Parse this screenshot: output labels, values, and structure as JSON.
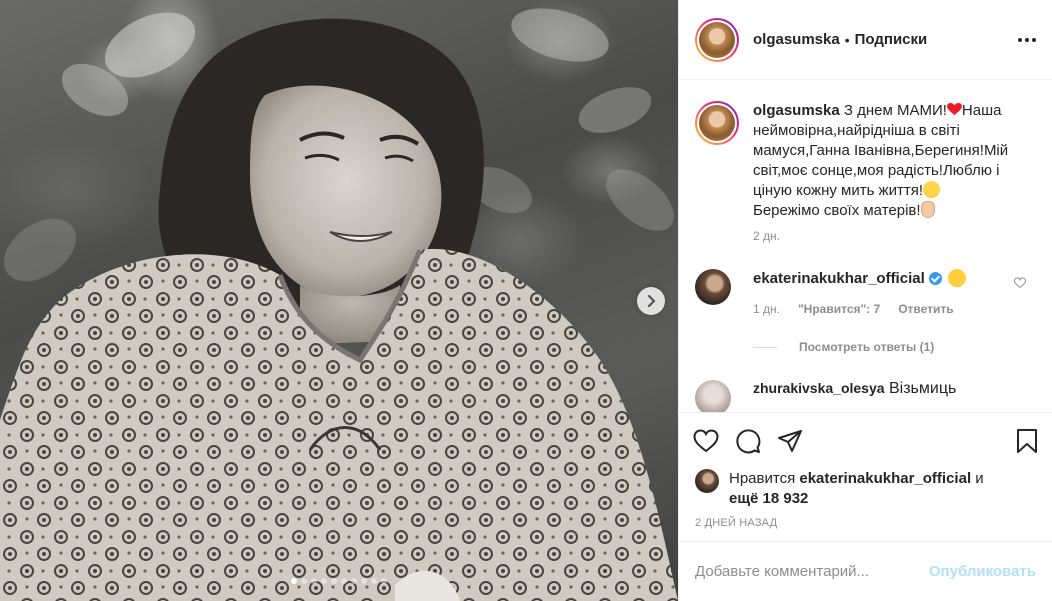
{
  "post": {
    "photo_alt": "",
    "slide_count": 10,
    "active_slide": 0
  },
  "header": {
    "username": "olgasumska",
    "separator": "•",
    "follow_label": "Подписки",
    "more_icon": "more-icon"
  },
  "caption": {
    "username": "olgasumska",
    "text_part1": " З днем МАМИ!",
    "text_part2": "Наша неймовірна,найрідніша в світі мамуся,Ганна Іванівна,Берегиня!Мій світ,моє сонце,моя радість!Люблю і ціную кожну мить життя!",
    "text_part3": " Бережімо своїх матерів!",
    "time": "2 дн."
  },
  "comments": [
    {
      "username": "ekaterinakukhar_official",
      "verified": true,
      "time": "1 дн.",
      "likes_label": "\"Нравится\": 7",
      "reply_label": "Ответить",
      "view_replies": "Посмотреть ответы (1)"
    },
    {
      "username": "zhurakivska_olesya",
      "text": "Візьмиць"
    }
  ],
  "actions": {
    "like_icon": "heart-icon",
    "comment_icon": "comment-icon",
    "share_icon": "share-icon",
    "save_icon": "bookmark-icon"
  },
  "likes": {
    "prefix": "Нравится ",
    "username": "ekaterinakukhar_official",
    "and": " и",
    "others": "ещё 18 932"
  },
  "post_date": "2 ДНЕЙ НАЗАД",
  "add_comment": {
    "placeholder": "Добавьте комментарий...",
    "publish_label": "Опубликовать"
  },
  "colors": {
    "text": "#262626",
    "secondary": "#8e8e8e",
    "link_disabled": "#b2dffc",
    "verified": "#3897f0",
    "heart_emoji": "#ed1c24"
  }
}
